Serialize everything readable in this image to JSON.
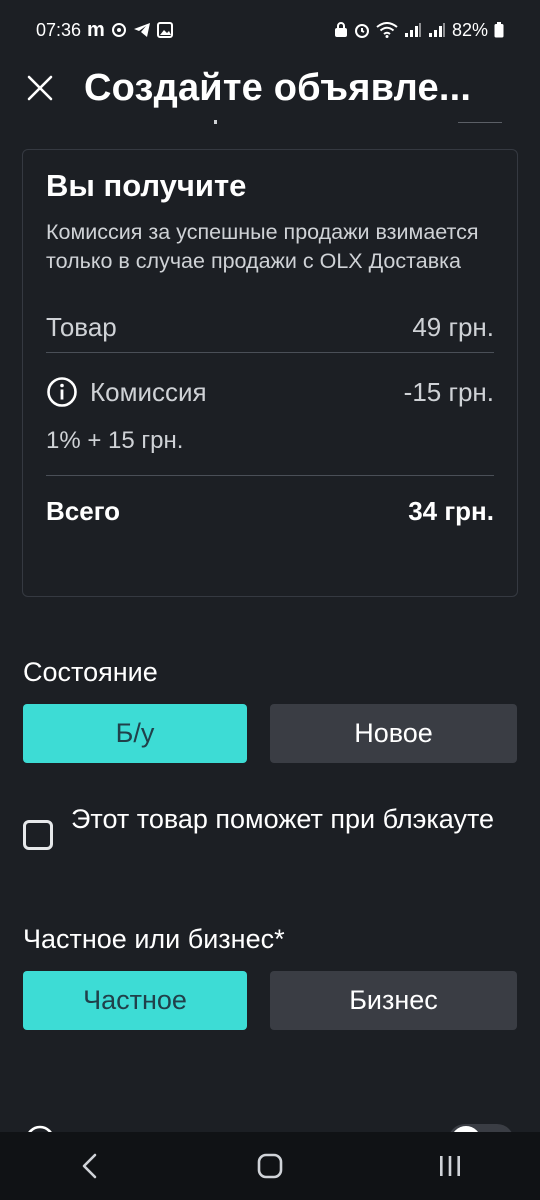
{
  "status_bar": {
    "time": "07:36",
    "brand": "m",
    "battery": "82%"
  },
  "header": {
    "title": "Создайте объявле..."
  },
  "summary": {
    "title": "Вы получите",
    "description": "Комиссия за успешные продажи взимается только в случае продажи с OLX Доставка",
    "product_label": "Товар",
    "product_value": "49 грн.",
    "commission_label": "Комиссия",
    "commission_value": "-15 грн.",
    "commission_formula": "1% + 15 грн.",
    "total_label": "Всего",
    "total_value": "34 грн."
  },
  "condition": {
    "label": "Состояние",
    "options": [
      "Б/у",
      "Новое"
    ],
    "selected": "Б/у"
  },
  "blackout_checkbox": {
    "label": "Этот товар поможет при блэкауте",
    "checked": false
  },
  "seller_type": {
    "label": "Частное или бизнес*",
    "options": [
      "Частное",
      "Бизнес"
    ],
    "selected": "Частное"
  },
  "colors": {
    "background": "#1c1f24",
    "accent": "#3ddcd5",
    "inactive_button": "#3a3d44",
    "nav_bar": "#101215"
  }
}
